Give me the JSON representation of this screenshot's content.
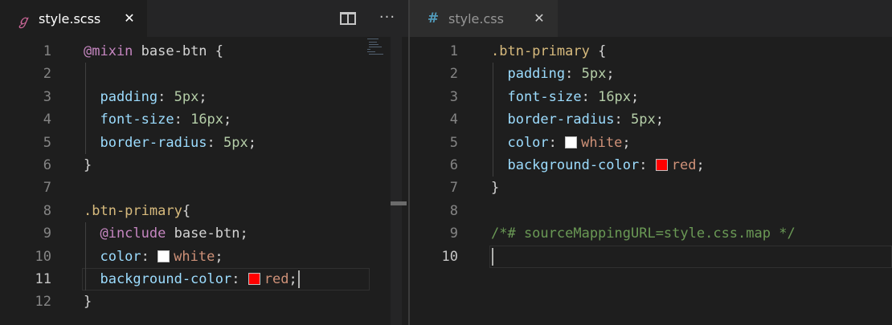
{
  "left_editor": {
    "tab": {
      "label": "style.scss",
      "icon": "sass-icon",
      "close": "✕",
      "active": true
    },
    "toolbar": {
      "split_icon": "split-editor-icon",
      "more": "···"
    },
    "current_line": 11,
    "lines": [
      {
        "n": "1",
        "tokens": [
          {
            "t": "@mixin",
            "c": "at"
          },
          {
            "t": " base-btn ",
            "c": "name"
          },
          {
            "t": "{",
            "c": "punc"
          }
        ]
      },
      {
        "n": "2",
        "tokens": []
      },
      {
        "n": "3",
        "tokens": [
          {
            "t": "  padding",
            "c": "prop"
          },
          {
            "t": ": ",
            "c": "punc"
          },
          {
            "t": "5px",
            "c": "num"
          },
          {
            "t": ";",
            "c": "punc"
          }
        ]
      },
      {
        "n": "4",
        "tokens": [
          {
            "t": "  font-size",
            "c": "prop"
          },
          {
            "t": ": ",
            "c": "punc"
          },
          {
            "t": "16px",
            "c": "num"
          },
          {
            "t": ";",
            "c": "punc"
          }
        ]
      },
      {
        "n": "5",
        "tokens": [
          {
            "t": "  border-radius",
            "c": "prop"
          },
          {
            "t": ": ",
            "c": "punc"
          },
          {
            "t": "5px",
            "c": "num"
          },
          {
            "t": ";",
            "c": "punc"
          }
        ]
      },
      {
        "n": "6",
        "tokens": [
          {
            "t": "}",
            "c": "punc"
          }
        ]
      },
      {
        "n": "7",
        "tokens": []
      },
      {
        "n": "8",
        "tokens": [
          {
            "t": ".btn-primary",
            "c": "sel"
          },
          {
            "t": "{",
            "c": "punc"
          }
        ]
      },
      {
        "n": "9",
        "tokens": [
          {
            "t": "  @include",
            "c": "at"
          },
          {
            "t": " base-btn",
            "c": "name"
          },
          {
            "t": ";",
            "c": "punc"
          }
        ]
      },
      {
        "n": "10",
        "tokens": [
          {
            "t": "  color",
            "c": "prop"
          },
          {
            "t": ": ",
            "c": "punc"
          },
          {
            "swatch": "#ffffff"
          },
          {
            "t": "white",
            "c": "str"
          },
          {
            "t": ";",
            "c": "punc"
          }
        ]
      },
      {
        "n": "11",
        "tokens": [
          {
            "t": "  background-color",
            "c": "prop"
          },
          {
            "t": ": ",
            "c": "punc"
          },
          {
            "swatch": "#ff0000"
          },
          {
            "t": "red",
            "c": "str"
          },
          {
            "t": ";",
            "c": "punc"
          }
        ]
      },
      {
        "n": "12",
        "tokens": [
          {
            "t": "}",
            "c": "punc"
          }
        ]
      }
    ]
  },
  "right_editor": {
    "tab": {
      "label": "style.css",
      "icon": "#",
      "close": "✕",
      "active": false
    },
    "current_line": 10,
    "lines": [
      {
        "n": "1",
        "tokens": [
          {
            "t": ".btn-primary",
            "c": "sel"
          },
          {
            "t": " {",
            "c": "punc"
          }
        ]
      },
      {
        "n": "2",
        "tokens": [
          {
            "t": "  padding",
            "c": "prop"
          },
          {
            "t": ": ",
            "c": "punc"
          },
          {
            "t": "5px",
            "c": "num"
          },
          {
            "t": ";",
            "c": "punc"
          }
        ]
      },
      {
        "n": "3",
        "tokens": [
          {
            "t": "  font-size",
            "c": "prop"
          },
          {
            "t": ": ",
            "c": "punc"
          },
          {
            "t": "16px",
            "c": "num"
          },
          {
            "t": ";",
            "c": "punc"
          }
        ]
      },
      {
        "n": "4",
        "tokens": [
          {
            "t": "  border-radius",
            "c": "prop"
          },
          {
            "t": ": ",
            "c": "punc"
          },
          {
            "t": "5px",
            "c": "num"
          },
          {
            "t": ";",
            "c": "punc"
          }
        ]
      },
      {
        "n": "5",
        "tokens": [
          {
            "t": "  color",
            "c": "prop"
          },
          {
            "t": ": ",
            "c": "punc"
          },
          {
            "swatch": "#ffffff"
          },
          {
            "t": "white",
            "c": "str"
          },
          {
            "t": ";",
            "c": "punc"
          }
        ]
      },
      {
        "n": "6",
        "tokens": [
          {
            "t": "  background-color",
            "c": "prop"
          },
          {
            "t": ": ",
            "c": "punc"
          },
          {
            "swatch": "#ff0000"
          },
          {
            "t": "red",
            "c": "str"
          },
          {
            "t": ";",
            "c": "punc"
          }
        ]
      },
      {
        "n": "7",
        "tokens": [
          {
            "t": "}",
            "c": "punc"
          }
        ]
      },
      {
        "n": "8",
        "tokens": []
      },
      {
        "n": "9",
        "tokens": [
          {
            "t": "/*# sourceMappingURL=style.css.map */",
            "c": "comment"
          }
        ]
      },
      {
        "n": "10",
        "tokens": []
      }
    ]
  },
  "colors": {
    "background": "#1e1e1e",
    "tabbar": "#252526",
    "property": "#9cdcfe",
    "selector": "#d7ba7d",
    "at_rule": "#c586c0",
    "number": "#b5cea8",
    "string": "#ce9178",
    "comment": "#6a9955"
  }
}
